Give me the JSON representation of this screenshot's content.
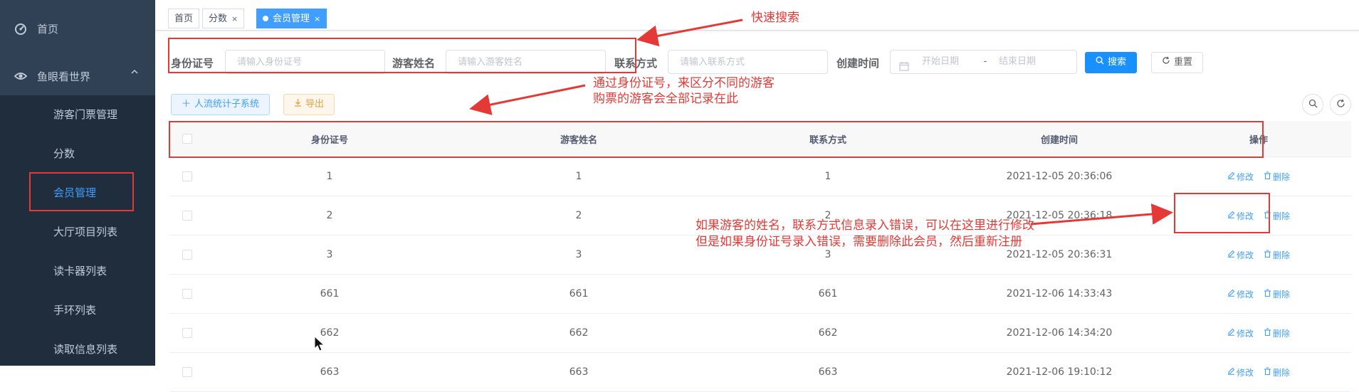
{
  "sidebar": {
    "home": "首页",
    "group": "鱼眼看世界",
    "items": [
      {
        "label": "游客门票管理",
        "active": false
      },
      {
        "label": "分数",
        "active": false
      },
      {
        "label": "会员管理",
        "active": true
      },
      {
        "label": "大厅项目列表",
        "active": false
      },
      {
        "label": "读卡器列表",
        "active": false
      },
      {
        "label": "手环列表",
        "active": false
      },
      {
        "label": "读取信息列表",
        "active": false
      }
    ]
  },
  "tags": [
    {
      "label": "首页",
      "closable": false,
      "active": false
    },
    {
      "label": "分数",
      "closable": true,
      "active": false
    },
    {
      "label": "会员管理",
      "closable": true,
      "active": true
    }
  ],
  "search": {
    "id_label": "身份证号",
    "id_placeholder": "请输入身份证号",
    "name_label": "游客姓名",
    "name_placeholder": "请输入游客姓名",
    "contact_label": "联系方式",
    "contact_placeholder": "请输入联系方式",
    "created_label": "创建时间",
    "start_placeholder": "开始日期",
    "range_sep": "-",
    "end_placeholder": "结束日期",
    "search_btn": "搜索",
    "reset_btn": "重置"
  },
  "toolbar": {
    "add_btn": "人流统计子系统",
    "export_btn": "导出"
  },
  "table": {
    "headers": [
      "身份证号",
      "游客姓名",
      "联系方式",
      "创建时间",
      "操作"
    ],
    "edit_label": "修改",
    "delete_label": "删除",
    "rows": [
      {
        "id": "1",
        "name": "1",
        "contact": "1",
        "created": "2021-12-05 20:36:06"
      },
      {
        "id": "2",
        "name": "2",
        "contact": "2",
        "created": "2021-12-05 20:36:18"
      },
      {
        "id": "3",
        "name": "3",
        "contact": "3",
        "created": "2021-12-05 20:36:31"
      },
      {
        "id": "661",
        "name": "661",
        "contact": "661",
        "created": "2021-12-06 14:33:43"
      },
      {
        "id": "662",
        "name": "662",
        "contact": "662",
        "created": "2021-12-06 14:34:20"
      },
      {
        "id": "663",
        "name": "663",
        "contact": "663",
        "created": "2021-12-06 19:10:12"
      }
    ]
  },
  "annotations": {
    "quick_search": "快速搜索",
    "id_note_line1": "通过身份证号，来区分不同的游客",
    "id_note_line2": "购票的游客会全部记录在此",
    "edit_note_line1": "如果游客的姓名，联系方式信息录入错误，可以在这里进行修改",
    "edit_note_line2": "但是如果身份证号录入错误，需要删除此会员，然后重新注册"
  },
  "colors": {
    "sidebar_bg": "#304156",
    "submenu_bg": "#1f2d3d",
    "accent": "#409eff",
    "annotation_red": "#e53935"
  }
}
